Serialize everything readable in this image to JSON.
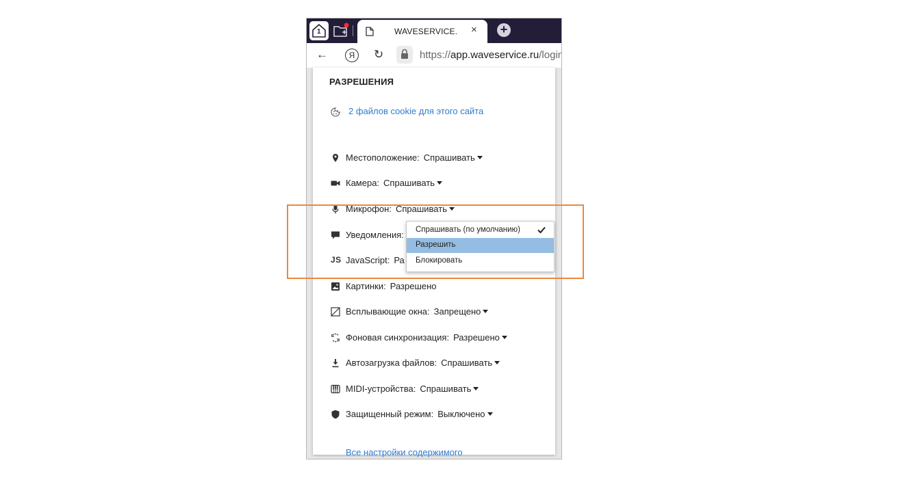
{
  "browser": {
    "tab": {
      "title": "WAVESERVICE.",
      "close": "×"
    },
    "new_tab": "+",
    "home_badge": "1",
    "back": "←",
    "yandex": "Я",
    "reload": "↻",
    "url_scheme": "https://",
    "url_host": "app.waveservice.ru",
    "url_path": "/login"
  },
  "panel": {
    "title": "РАЗРЕШЕНИЯ",
    "cookie_link": "2 файлов cookie для этого сайта",
    "permissions": [
      {
        "icon": "location-pin-icon",
        "label": "Местоположение:",
        "value": "Спрашивать"
      },
      {
        "icon": "camera-icon",
        "label": "Камера:",
        "value": "Спрашивать"
      },
      {
        "icon": "microphone-icon",
        "label": "Микрофон:",
        "value": "Спрашивать"
      },
      {
        "icon": "notification-icon",
        "label": "Уведомления:",
        "value": ""
      },
      {
        "icon": "js-icon",
        "label": "JavaScript:",
        "value": "Ра"
      },
      {
        "icon": "image-icon",
        "label": "Картинки:",
        "value": "Разрешено"
      },
      {
        "icon": "popup-icon",
        "label": "Всплывающие окна:",
        "value": "Запрещено"
      },
      {
        "icon": "sync-icon",
        "label": "Фоновая синхронизация:",
        "value": "Разрешено"
      },
      {
        "icon": "download-icon",
        "label": "Автозагрузка файлов:",
        "value": "Спрашивать"
      },
      {
        "icon": "midi-icon",
        "label": "MIDI-устройства:",
        "value": "Спрашивать"
      },
      {
        "icon": "shield-icon",
        "label": "Защищенный режим:",
        "value": "Выключено"
      }
    ],
    "js_icon_text": "JS",
    "all_settings_link": "Все настройки содержимого"
  },
  "dropdown": {
    "options": [
      {
        "label": "Спрашивать (по умолчанию)",
        "checked": true
      },
      {
        "label": "Разрешить",
        "highlighted": true
      },
      {
        "label": "Блокировать"
      }
    ]
  },
  "colors": {
    "tabstrip": "#231d38",
    "link": "#2e7bcf",
    "highlight_border": "#e8893f",
    "selected_option": "#95bde3"
  }
}
